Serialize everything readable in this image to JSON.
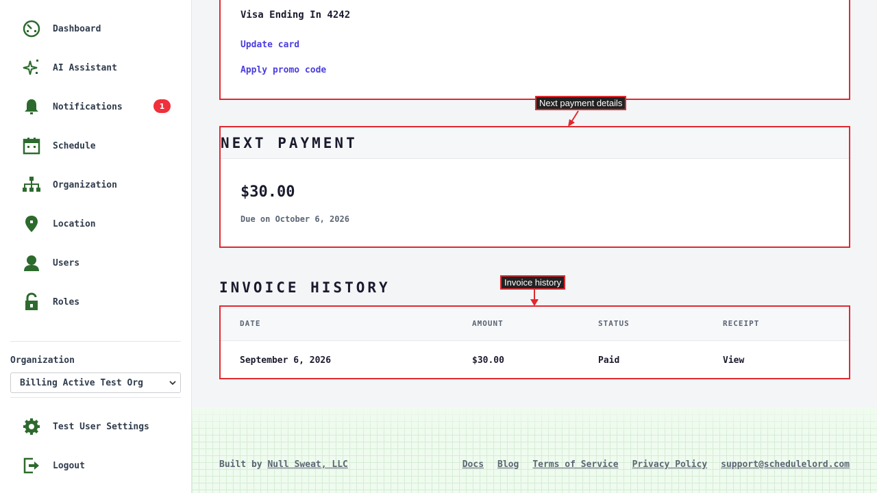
{
  "sidebar": {
    "items": [
      {
        "label": "Dashboard",
        "icon": "dashboard-icon"
      },
      {
        "label": "AI Assistant",
        "icon": "sparkle-icon"
      },
      {
        "label": "Notifications",
        "icon": "bell-icon",
        "badge": "1"
      },
      {
        "label": "Schedule",
        "icon": "calendar-icon"
      },
      {
        "label": "Organization",
        "icon": "org-chart-icon"
      },
      {
        "label": "Location",
        "icon": "location-pin-icon"
      },
      {
        "label": "Users",
        "icon": "user-icon"
      },
      {
        "label": "Roles",
        "icon": "lock-icon"
      }
    ],
    "organization_label": "Organization",
    "organization_selected": "Billing Active Test Org",
    "bottom_items": [
      {
        "label": "Test User Settings",
        "icon": "gear-icon"
      },
      {
        "label": "Logout",
        "icon": "logout-icon"
      }
    ]
  },
  "payment_method": {
    "card_label": "Visa Ending In 4242",
    "update_link": "Update card",
    "promo_link": "Apply promo code"
  },
  "next_payment": {
    "title": "NEXT PAYMENT",
    "amount": "$30.00",
    "due": "Due on October 6, 2026"
  },
  "invoice_history": {
    "title": "INVOICE HISTORY",
    "columns": [
      "DATE",
      "AMOUNT",
      "STATUS",
      "RECEIPT"
    ],
    "rows": [
      {
        "date": "September 6, 2026",
        "amount": "$30.00",
        "status": "Paid",
        "receipt": "View"
      }
    ]
  },
  "annotations": {
    "next_payment": "Next payment details",
    "invoice_history": "Invoice history"
  },
  "footer": {
    "built_by_prefix": "Built by",
    "built_by_link": "Null Sweat, LLC",
    "links": [
      "Docs",
      "Blog",
      "Terms of Service",
      "Privacy Policy",
      "support@schedulelord.com"
    ]
  },
  "colors": {
    "accent_green": "#2d6a2d",
    "highlight_red": "#e0282e",
    "link_blue": "#4a3de0",
    "badge_red": "#f0303a"
  }
}
